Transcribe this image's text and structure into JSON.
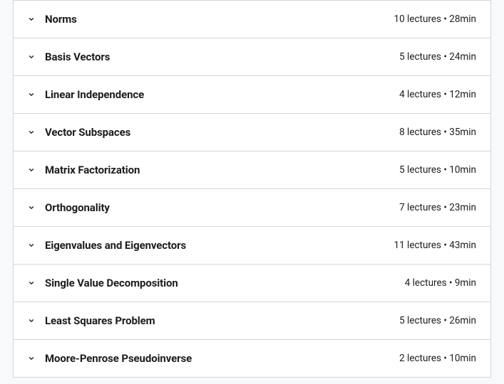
{
  "sections": [
    {
      "title": "Norms",
      "lectures": 10,
      "minutes": 28
    },
    {
      "title": "Basis Vectors",
      "lectures": 5,
      "minutes": 24
    },
    {
      "title": "Linear Independence",
      "lectures": 4,
      "minutes": 12
    },
    {
      "title": "Vector Subspaces",
      "lectures": 8,
      "minutes": 35
    },
    {
      "title": "Matrix Factorization",
      "lectures": 5,
      "minutes": 10
    },
    {
      "title": "Orthogonality",
      "lectures": 7,
      "minutes": 23
    },
    {
      "title": "Eigenvalues and Eigenvectors",
      "lectures": 11,
      "minutes": 43
    },
    {
      "title": "Single Value Decomposition",
      "lectures": 4,
      "minutes": 9
    },
    {
      "title": "Least Squares Problem",
      "lectures": 5,
      "minutes": 26
    },
    {
      "title": "Moore-Penrose Pseudoinverse",
      "lectures": 2,
      "minutes": 10
    }
  ],
  "labels": {
    "lectures_word": "lectures",
    "separator": " • ",
    "minutes_suffix": "min"
  }
}
